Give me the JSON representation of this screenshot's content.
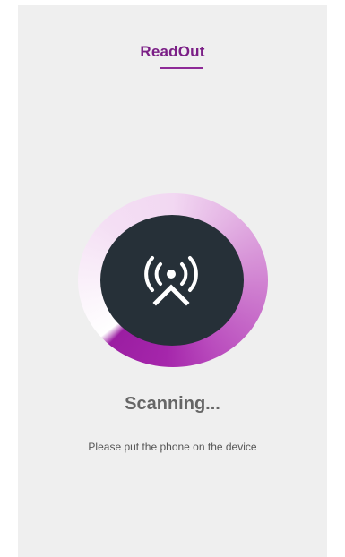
{
  "header": {
    "title": "ReadOut"
  },
  "scanner": {
    "icon": "nfc-broadcast-icon",
    "progress": 0.65,
    "status_text": "Scanning...",
    "hint_text": "Please put the phone on the device"
  },
  "colors": {
    "accent": "#8e2a97",
    "title": "#7b1f86",
    "background": "#efefef",
    "icon_circle": "#263038"
  }
}
